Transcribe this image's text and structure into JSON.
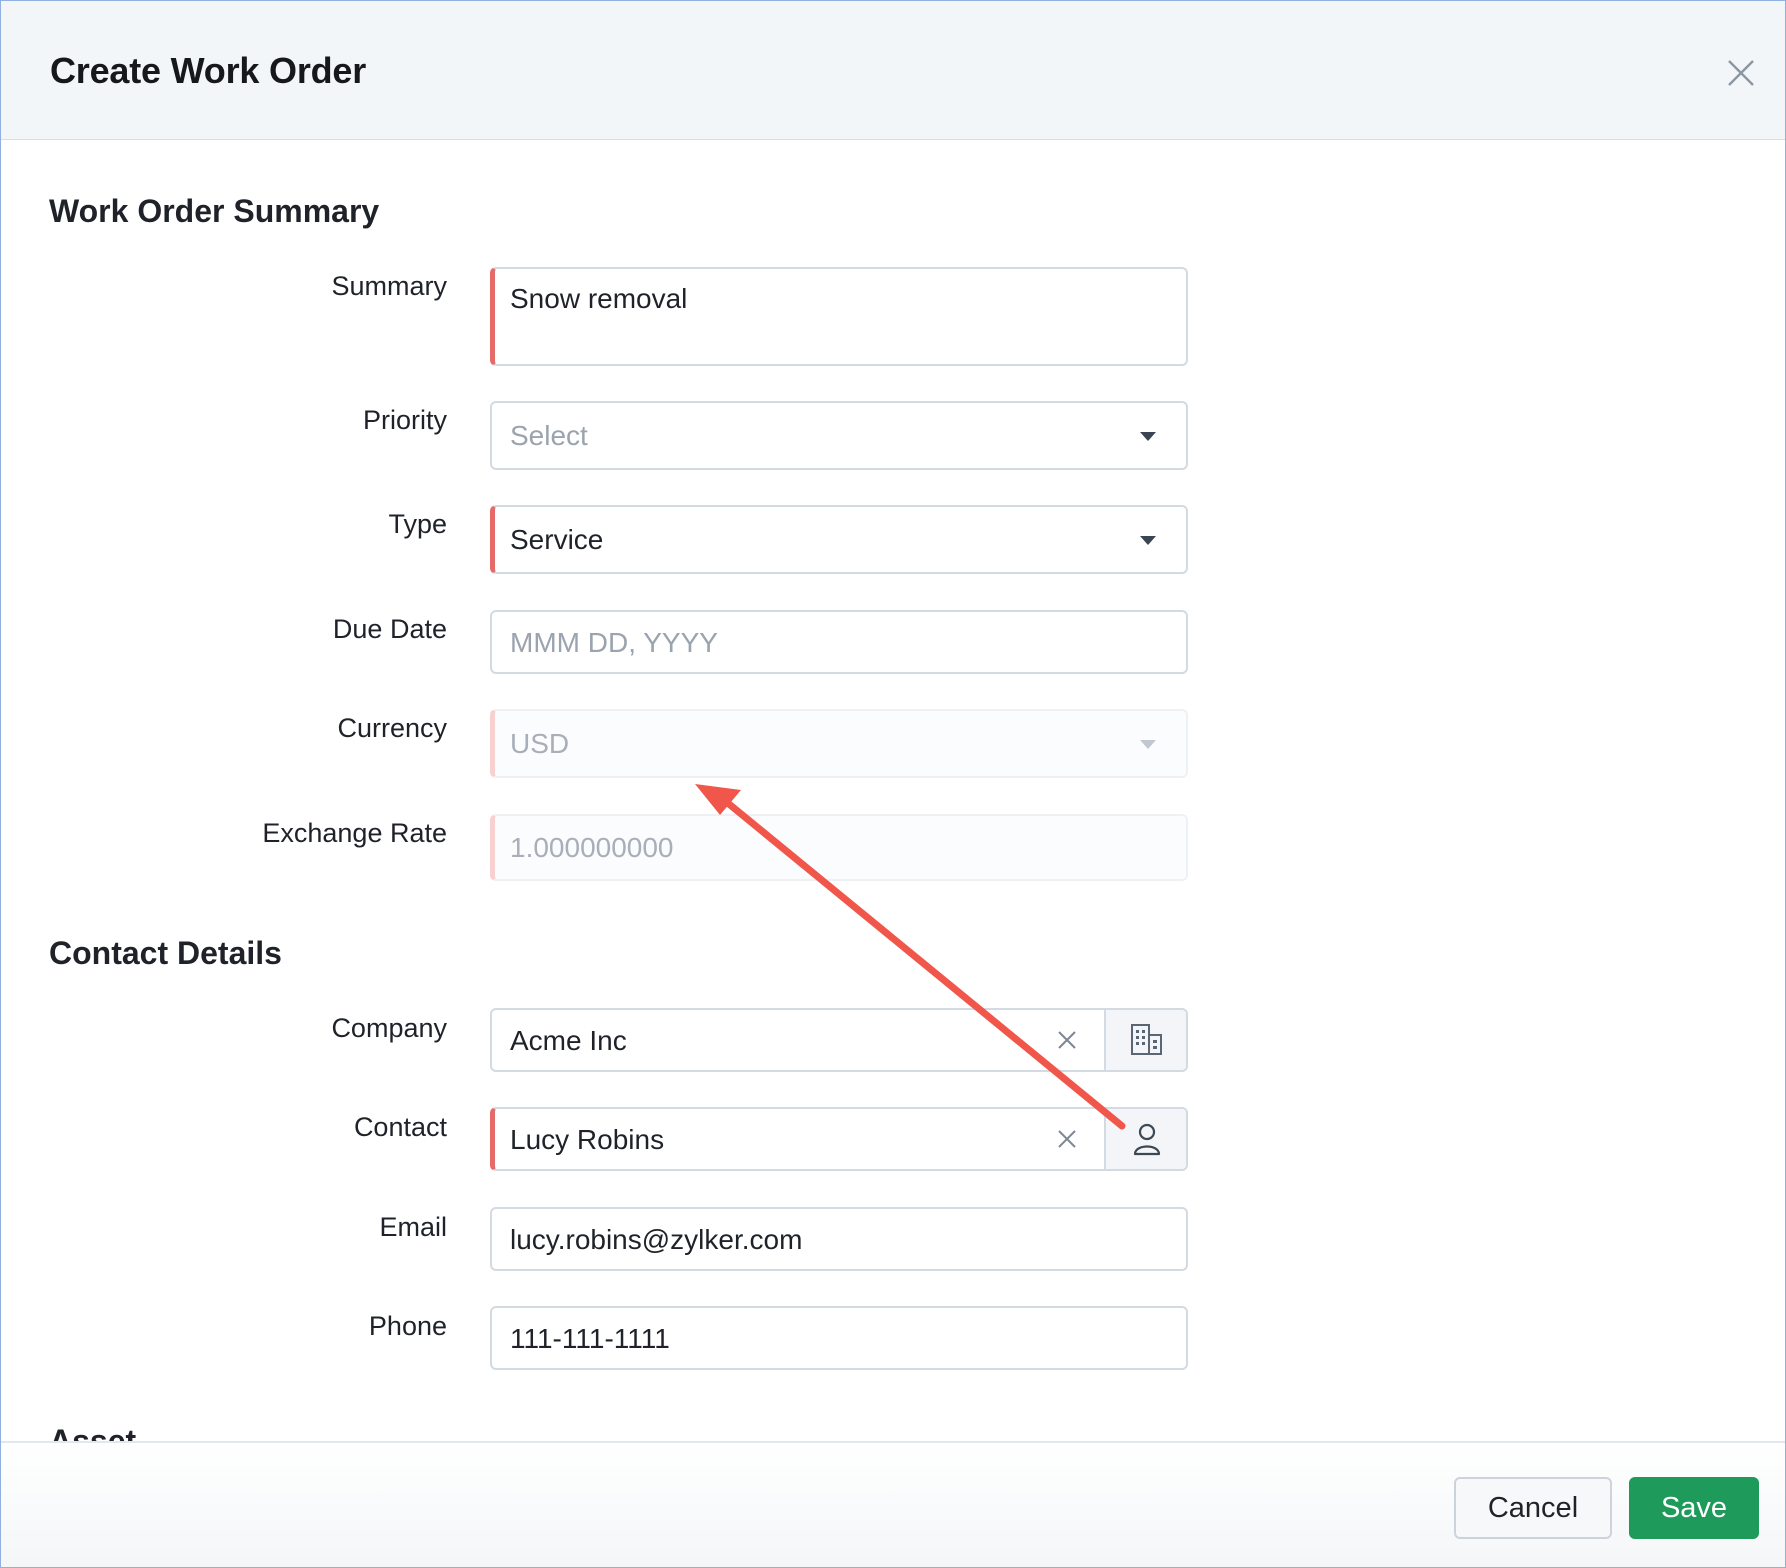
{
  "dialog": {
    "title": "Create Work Order"
  },
  "sections": {
    "summary_title": "Work Order Summary",
    "contact_title": "Contact Details",
    "asset_title": "Asset"
  },
  "fields": {
    "summary": {
      "label": "Summary",
      "value": "Snow removal"
    },
    "priority": {
      "label": "Priority",
      "placeholder": "Select"
    },
    "type": {
      "label": "Type",
      "value": "Service"
    },
    "due_date": {
      "label": "Due Date",
      "placeholder": "MMM DD, YYYY"
    },
    "currency": {
      "label": "Currency",
      "value": "USD"
    },
    "exchange_rate": {
      "label": "Exchange Rate",
      "value": "1.000000000"
    },
    "company": {
      "label": "Company",
      "value": "Acme Inc"
    },
    "contact": {
      "label": "Contact",
      "value": "Lucy Robins"
    },
    "email": {
      "label": "Email",
      "value": "lucy.robins@zylker.com"
    },
    "phone": {
      "label": "Phone",
      "value": "111-111-1111"
    }
  },
  "footer": {
    "cancel_label": "Cancel",
    "save_label": "Save"
  },
  "icons": {
    "close": "close-icon",
    "company_lookup": "building-icon",
    "contact_lookup": "user-icon",
    "dropdown": "chevron-down-icon",
    "clear": "clear-icon"
  },
  "colors": {
    "required_marker": "#e56b6b",
    "save_button": "#1e9b5b",
    "annotation_arrow": "#f0564a",
    "header_bg": "#f3f6f8"
  }
}
